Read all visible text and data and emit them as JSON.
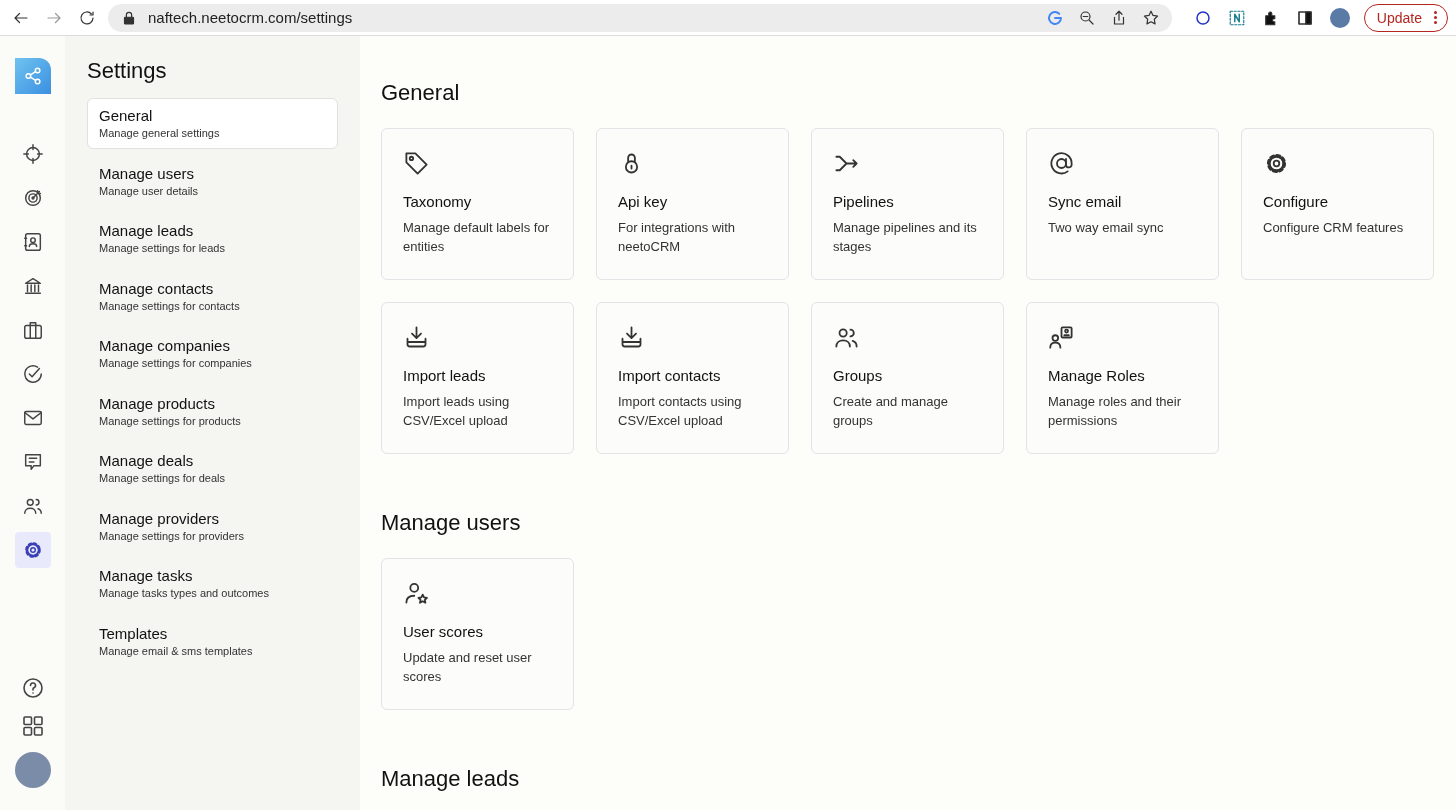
{
  "browser": {
    "url": "naftech.neetocrm.com/settings",
    "update_button": "Update"
  },
  "rail": {
    "items": [
      {
        "selected": false
      },
      {
        "selected": false
      },
      {
        "selected": false
      },
      {
        "selected": false
      },
      {
        "selected": false
      },
      {
        "selected": false
      },
      {
        "selected": false
      },
      {
        "selected": false
      },
      {
        "selected": false
      },
      {
        "selected": true
      }
    ]
  },
  "settings_nav": {
    "title": "Settings",
    "items": [
      {
        "title": "General",
        "subtitle": "Manage general settings",
        "selected": true
      },
      {
        "title": "Manage users",
        "subtitle": "Manage user details",
        "selected": false
      },
      {
        "title": "Manage leads",
        "subtitle": "Manage settings for leads",
        "selected": false
      },
      {
        "title": "Manage contacts",
        "subtitle": "Manage settings for contacts",
        "selected": false
      },
      {
        "title": "Manage companies",
        "subtitle": "Manage settings for companies",
        "selected": false
      },
      {
        "title": "Manage products",
        "subtitle": "Manage settings for products",
        "selected": false
      },
      {
        "title": "Manage deals",
        "subtitle": "Manage settings for deals",
        "selected": false
      },
      {
        "title": "Manage providers",
        "subtitle": "Manage settings for providers",
        "selected": false
      },
      {
        "title": "Manage tasks",
        "subtitle": "Manage tasks types and outcomes",
        "selected": false
      },
      {
        "title": "Templates",
        "subtitle": "Manage email & sms templates",
        "selected": false
      }
    ]
  },
  "sections": [
    {
      "heading": "General",
      "cards": [
        {
          "title": "Taxonomy",
          "description": "Manage default labels for entities"
        },
        {
          "title": "Api key",
          "description": "For integrations with neetoCRM"
        },
        {
          "title": "Pipelines",
          "description": "Manage pipelines and its stages"
        },
        {
          "title": "Sync email",
          "description": "Two way email sync"
        },
        {
          "title": "Configure",
          "description": "Configure CRM features"
        },
        {
          "title": "Import leads",
          "description": "Import leads using CSV/Excel upload"
        },
        {
          "title": "Import contacts",
          "description": "Import contacts using CSV/Excel upload"
        },
        {
          "title": "Groups",
          "description": "Create and manage groups"
        },
        {
          "title": "Manage Roles",
          "description": "Manage roles and their permissions"
        }
      ]
    },
    {
      "heading": "Manage users",
      "cards": [
        {
          "title": "User scores",
          "description": "Update and reset user scores"
        }
      ]
    },
    {
      "heading": "Manage leads"
    }
  ]
}
